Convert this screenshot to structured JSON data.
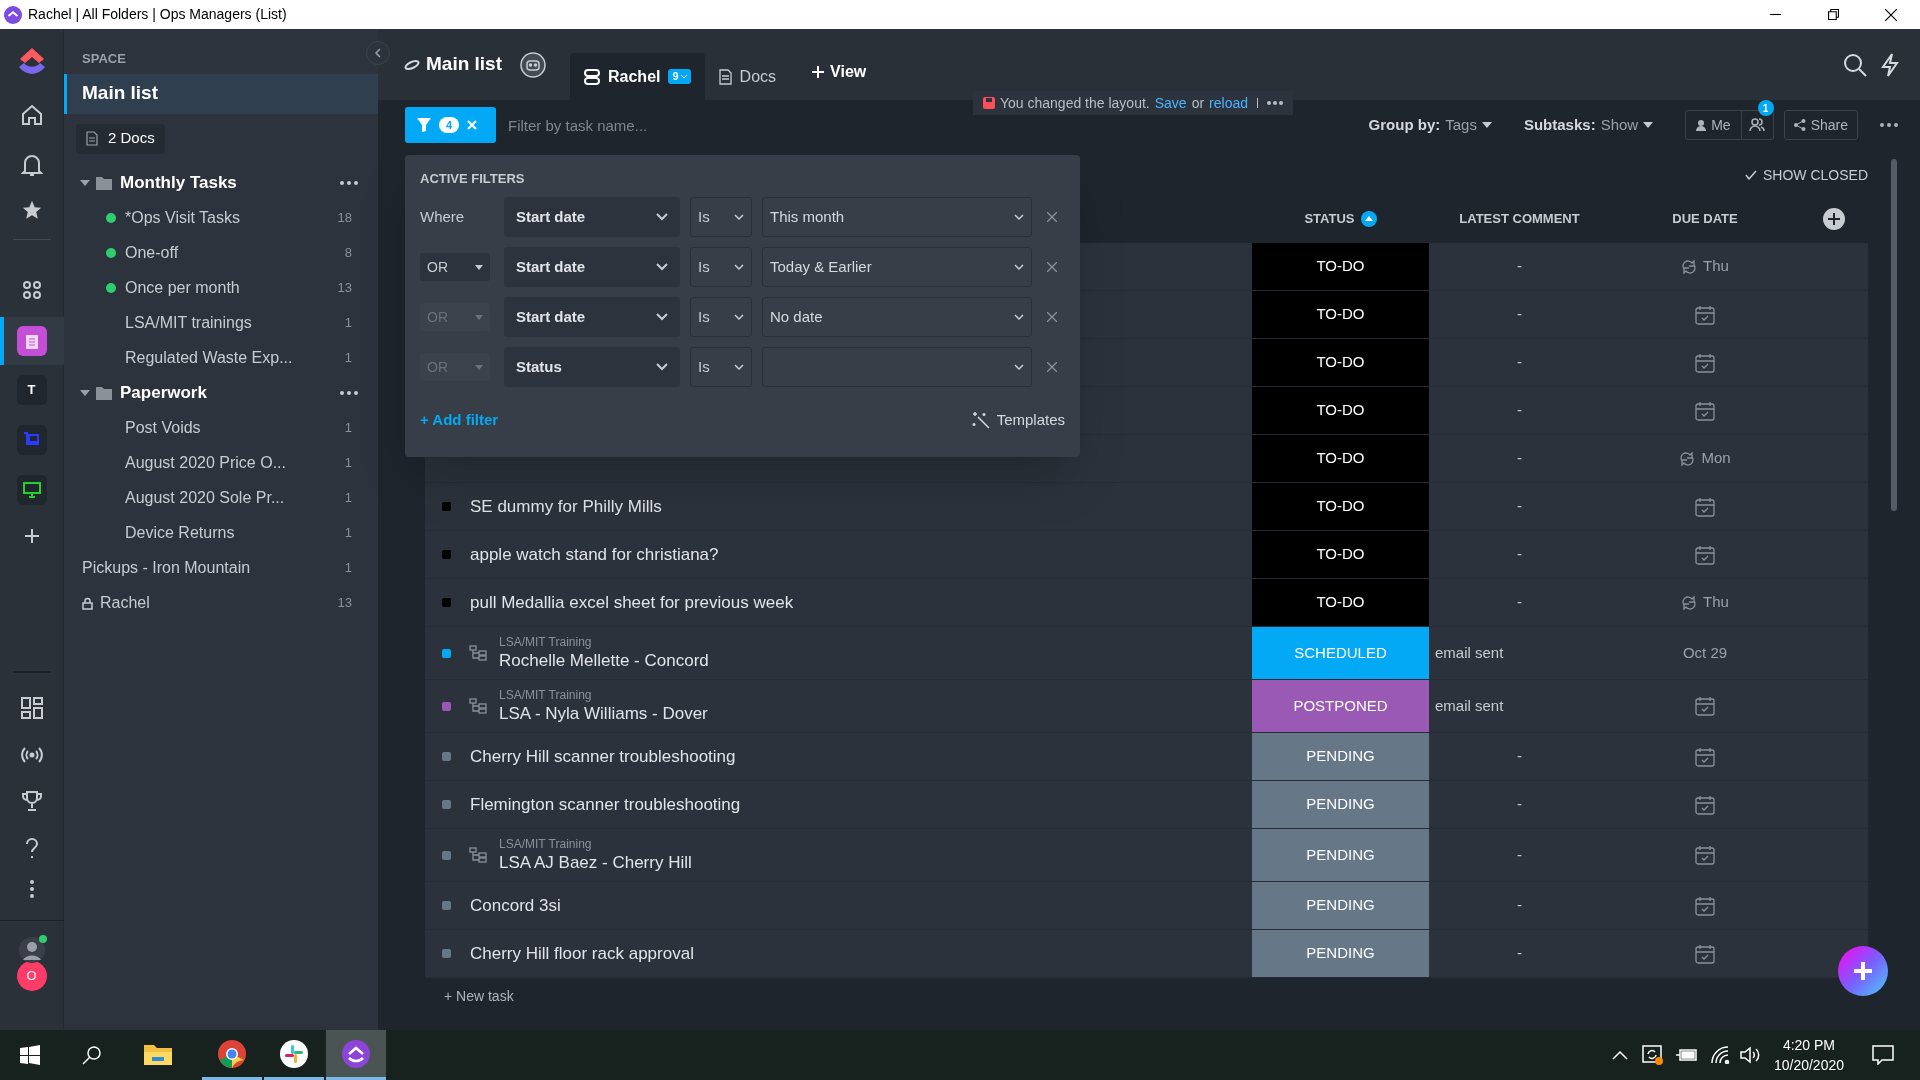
{
  "window": {
    "title": "Rachel | All Folders | Ops Managers (List)"
  },
  "rail": {
    "workspace_letter": "T",
    "avatar_letter": "O"
  },
  "sidebar": {
    "space_label": "SPACE",
    "current": "Main list",
    "docs": "2 Docs",
    "folders": [
      {
        "name": "Monthly Tasks",
        "expanded": true,
        "children": [
          {
            "name": "*Ops Visit Tasks",
            "count": "18",
            "color": "#2ecd6f"
          },
          {
            "name": "One-off",
            "count": "8",
            "color": "#2ecd6f"
          },
          {
            "name": "Once per month",
            "count": "13",
            "color": "#2ecd6f"
          },
          {
            "name": "LSA/MIT trainings",
            "count": "1"
          },
          {
            "name": "Regulated Waste Exp...",
            "count": "1"
          }
        ]
      },
      {
        "name": "Paperwork",
        "expanded": true,
        "children": [
          {
            "name": "Post Voids",
            "count": "1"
          },
          {
            "name": "August 2020 Price O...",
            "count": "1"
          },
          {
            "name": "August 2020 Sole Pr...",
            "count": "1"
          },
          {
            "name": "Device Returns",
            "count": "1"
          }
        ]
      }
    ],
    "lists": [
      {
        "name": "Pickups - Iron Mountain",
        "count": "1",
        "locked": false
      },
      {
        "name": "Rachel",
        "count": "13",
        "locked": true
      }
    ]
  },
  "header": {
    "title": "Main list",
    "tabs": [
      {
        "label": "Rachel",
        "badge": "9",
        "selected": true
      },
      {
        "label": "Docs",
        "selected": false
      }
    ],
    "add_view": "View"
  },
  "toolbar": {
    "filter_count": "4",
    "search_placeholder": "Filter by task name...",
    "notice": "You changed the layout.",
    "save": "Save",
    "or": "or",
    "reload": "reload",
    "group_by_label": "Group by:",
    "group_by_value": "Tags",
    "subtasks_label": "Subtasks:",
    "subtasks_value": "Show",
    "me": "Me",
    "people_badge": "1",
    "share": "Share"
  },
  "filter_panel": {
    "title": "ACTIVE FILTERS",
    "rows": [
      {
        "kind": "where",
        "conjunction": "Where",
        "field": "Start date",
        "operator": "Is",
        "value": "This month"
      },
      {
        "kind": "dropdown",
        "conjunction": "OR",
        "disabled": false,
        "field": "Start date",
        "operator": "Is",
        "value": "Today & Earlier"
      },
      {
        "kind": "dropdown",
        "conjunction": "OR",
        "disabled": true,
        "field": "Start date",
        "operator": "Is",
        "value": "No date"
      },
      {
        "kind": "dropdown",
        "conjunction": "OR",
        "disabled": true,
        "field": "Status",
        "operator": "Is"
      }
    ],
    "add_filter": "+ Add filter",
    "templates": "Templates"
  },
  "table": {
    "show_closed": "SHOW CLOSED",
    "columns": [
      "STATUS",
      "LATEST COMMENT",
      "DUE DATE"
    ],
    "rows": [
      {
        "status": "TO-DO",
        "color": "#000000",
        "comment": "-",
        "kind": "recurring",
        "due": "Thu"
      },
      {
        "status": "TO-DO",
        "color": "#000000",
        "comment": "-",
        "kind": "empty"
      },
      {
        "status": "TO-DO",
        "color": "#000000",
        "comment": "-",
        "kind": "empty"
      },
      {
        "status": "TO-DO",
        "color": "#000000",
        "comment": "-",
        "kind": "empty"
      },
      {
        "status": "TO-DO",
        "color": "#000000",
        "comment": "-",
        "kind": "recurring",
        "due": "Mon"
      },
      {
        "title": "SE dummy for Philly Mills",
        "status": "TO-DO",
        "color": "#000000",
        "comment": "-",
        "kind": "empty"
      },
      {
        "title": "apple watch stand for christiana?",
        "status": "TO-DO",
        "color": "#000000",
        "comment": "-",
        "kind": "empty"
      },
      {
        "title": "pull Medallia excel sheet for previous week",
        "status": "TO-DO",
        "color": "#000000",
        "comment": "-",
        "kind": "recurring",
        "due": "Thu"
      },
      {
        "title": "Rochelle Mellette - Concord",
        "list": "LSA/MIT Training",
        "status": "SCHEDULED",
        "color": "#03a9f4",
        "comment": "email sent",
        "kind": "date",
        "due": "Oct 29"
      },
      {
        "title": "LSA - Nyla Williams - Dover",
        "list": "LSA/MIT Training",
        "status": "POSTPONED",
        "color": "#9b59b6",
        "comment": "email sent",
        "kind": "empty"
      },
      {
        "title": "Cherry Hill scanner troubleshooting",
        "status": "PENDING",
        "color": "#667788",
        "comment": "-",
        "kind": "empty"
      },
      {
        "title": "Flemington scanner troubleshooting",
        "status": "PENDING",
        "color": "#667788",
        "comment": "-",
        "kind": "empty"
      },
      {
        "title": "LSA AJ Baez - Cherry Hill",
        "list": "LSA/MIT Training",
        "status": "PENDING",
        "color": "#667788",
        "comment": "-",
        "kind": "empty"
      },
      {
        "title": "Concord 3si",
        "status": "PENDING",
        "color": "#667788",
        "comment": "-",
        "kind": "empty"
      },
      {
        "title": "Cherry Hill floor rack approval",
        "status": "PENDING",
        "color": "#667788",
        "comment": "-",
        "kind": "empty"
      }
    ],
    "new_task": "+ New task"
  },
  "taskbar": {
    "time": "4:20 PM",
    "date": "10/20/2020"
  }
}
